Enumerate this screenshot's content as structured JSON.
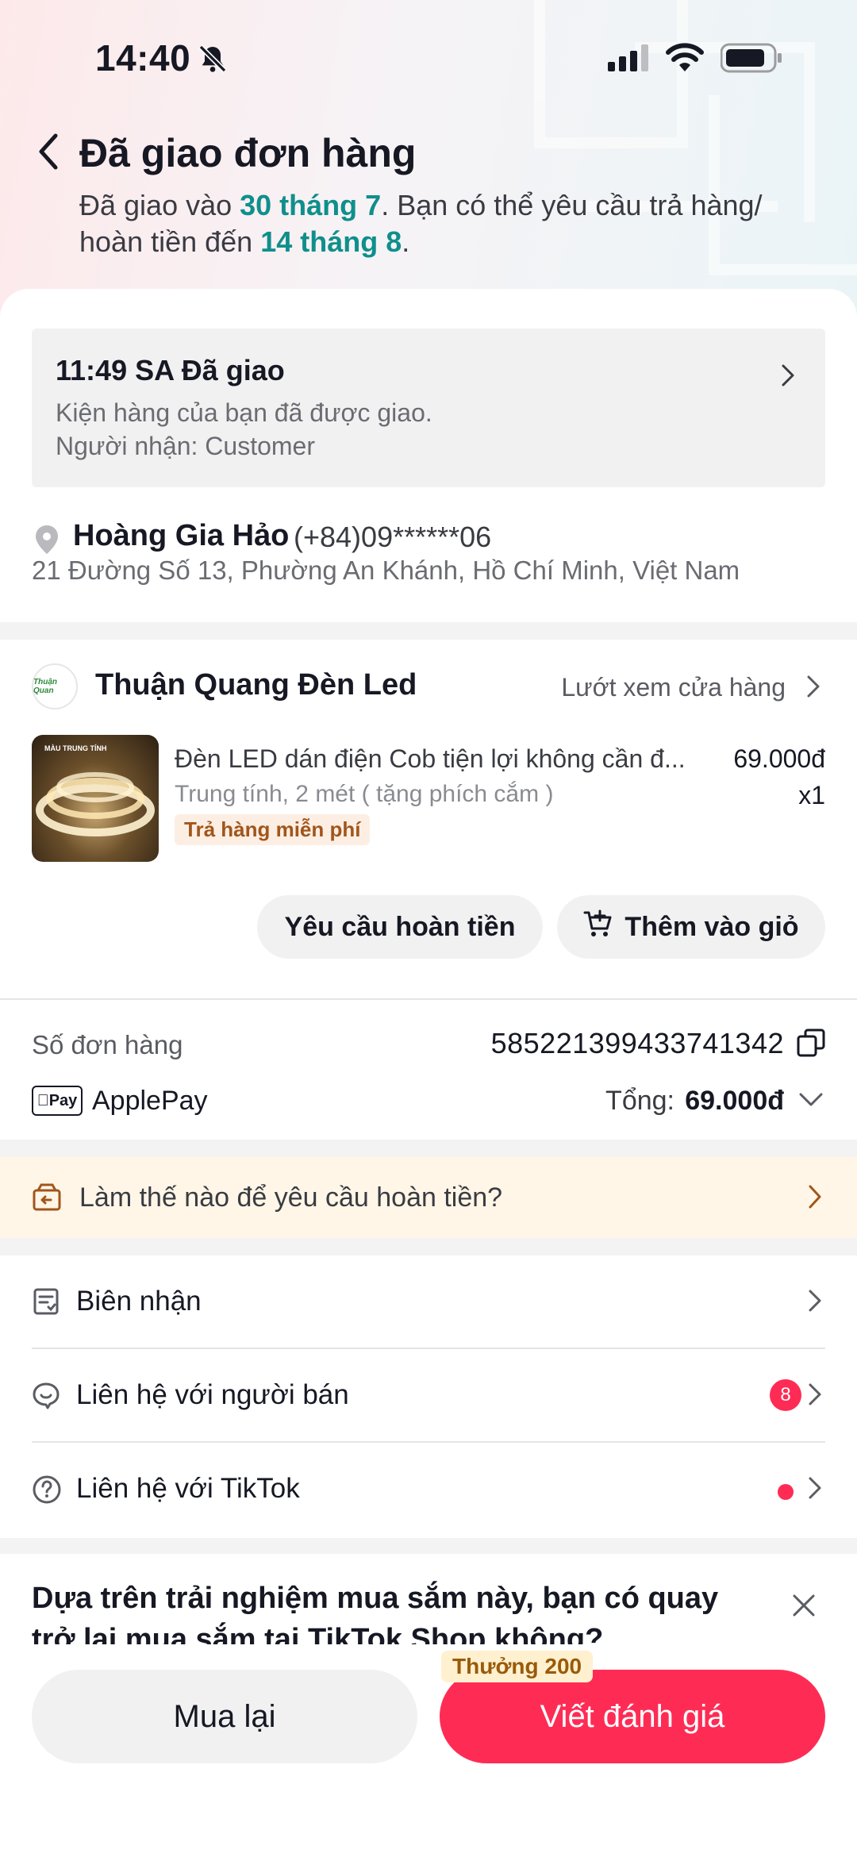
{
  "status_bar": {
    "time": "14:40"
  },
  "header": {
    "title": "Đã giao đơn hàng",
    "subtitle_part1": "Đã giao vào ",
    "delivered_date": "30 tháng 7",
    "subtitle_part2": ". Bạn có thể yêu cầu trả hàng/ hoàn tiền đến ",
    "refund_deadline": "14 tháng 8",
    "subtitle_part3": "."
  },
  "delivery": {
    "status": "11:49 SA Đã giao",
    "message": "Kiện hàng của bạn đã được giao.",
    "recipient": "Người nhận: Customer"
  },
  "address": {
    "name": "Hoàng Gia Hảo",
    "phone": "(+84)09******06",
    "line": "21 Đường Số 13, Phường An Khánh, Hồ Chí Minh, Việt Nam"
  },
  "store": {
    "logo_text": "Thuận Quan",
    "name": "Thuận Quang Đèn Led",
    "browse_label": "Lướt xem cửa hàng"
  },
  "product": {
    "thumb_label": "MÀU TRUNG TÍNH",
    "title": "Đèn LED dán điện Cob tiện lợi không cần đ...",
    "price": "69.000đ",
    "variant": "Trung tính, 2 mét ( tặng phích cắm )",
    "quantity": "x1",
    "badge": "Trả hàng miễn phí"
  },
  "actions": {
    "refund_label": "Yêu cầu hoàn tiền",
    "cart_label": "Thêm vào giỏ"
  },
  "order": {
    "number_label": "Số đơn hàng",
    "number": "585221399433741342",
    "pay_logo": "Pay",
    "payment_method": "ApplePay",
    "total_label": "Tổng:",
    "total_value": "69.000đ"
  },
  "refund_help": {
    "text": "Làm thế nào để yêu cầu hoàn tiền?"
  },
  "links": {
    "receipt": "Biên nhận",
    "contact_seller": "Liên hệ với người bán",
    "seller_unread": "8",
    "contact_tiktok": "Liên hệ với TikTok"
  },
  "survey": {
    "question": "Dựa trên trải nghiệm mua sắm này, bạn có quay trở lại mua sắm tại TikTok Shop không?"
  },
  "bottom": {
    "rebuy_label": "Mua lại",
    "review_label": "Viết đánh giá",
    "reward_label": "Thưởng 200"
  },
  "colors": {
    "accent": "#fe2c55",
    "highlight_teal": "#0f8f8c",
    "notice_bg": "#fff6e7"
  }
}
